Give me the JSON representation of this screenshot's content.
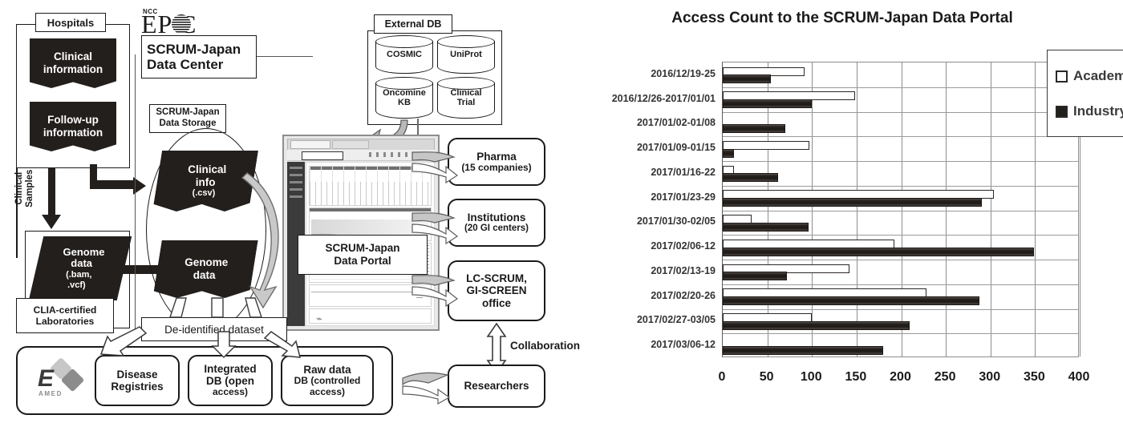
{
  "diagram": {
    "hospitals": {
      "label": "Hospitals",
      "items": [
        "Clinical\ninformation",
        "Follow-up\ninformation"
      ],
      "clinical_information_line1": "Clinical",
      "clinical_information_line2": "information",
      "followup_line1": "Follow-up",
      "followup_line2": "information"
    },
    "clinical_samples_label_line1": "Clinical",
    "clinical_samples_label_line2": "Samples",
    "lab": {
      "genome_line1": "Genome",
      "genome_line2": "data",
      "genome_line3": "(.bam,",
      "genome_line4": ".vcf)",
      "caption_line1": "CLIA-certified",
      "caption_line2": "Laboratories"
    },
    "epoc": {
      "ncc": "NCC",
      "wordmark": "EP  C",
      "title_line1": "SCRUM-Japan",
      "title_line2": "Data Center"
    },
    "storage": {
      "label_line1": "SCRUM-Japan",
      "label_line2": "Data Storage",
      "clinical_line1": "Clinical",
      "clinical_line2": "info",
      "clinical_line3": "(.csv)",
      "genome_line1": "Genome",
      "genome_line2": "data"
    },
    "external_db": {
      "label": "External DB",
      "items": [
        {
          "line1": "COSMIC",
          "line2": ""
        },
        {
          "line1": "UniProt",
          "line2": ""
        },
        {
          "line1": "Oncomine",
          "line2": "KB"
        },
        {
          "line1": "Clinical",
          "line2": "Trial"
        }
      ]
    },
    "portal": {
      "line1": "SCRUM-Japan",
      "line2": "Data Portal"
    },
    "consumers": [
      {
        "line1": "Pharma",
        "line2": "(15 companies)",
        "line3": ""
      },
      {
        "line1": "Institutions",
        "line2": "(20 GI centers)",
        "line3": ""
      },
      {
        "line1": "LC-SCRUM,",
        "line2": "GI-SCREEN",
        "line3": "office"
      }
    ],
    "collaboration_label": "Collaboration",
    "researchers_label": "Researchers",
    "deidentified_label": "De-identified dataset",
    "outputs": [
      {
        "line1": "Disease",
        "line2": "Registries",
        "line3": ""
      },
      {
        "line1": "Integrated",
        "line2": "DB (open",
        "line3": "access)"
      },
      {
        "line1": "Raw data",
        "line2": "DB (controlled",
        "line3": "access)"
      }
    ],
    "amed_logo_text": "AMED"
  },
  "chart_data": {
    "type": "bar",
    "orientation": "horizontal",
    "title": "Access Count to the SCRUM-Japan Data Portal",
    "xlabel": "",
    "ylabel": "",
    "xlim": [
      0,
      400
    ],
    "xticks": [
      0,
      50,
      100,
      150,
      200,
      250,
      300,
      350,
      400
    ],
    "grid": true,
    "legend_position": "top-right",
    "categories": [
      "2016/12/19-25",
      "2016/12/26-2017/01/01",
      "2017/01/02-01/08",
      "2017/01/09-01/15",
      "2017/01/16-22",
      "2017/01/23-29",
      "2017/01/30-02/05",
      "2017/02/06-12",
      "2017/02/13-19",
      "2017/02/20-26",
      "2017/02/27-03/05",
      "2017/03/06-12"
    ],
    "series": [
      {
        "name": "Academia",
        "color": "#ffffff",
        "values": [
          92,
          148,
          0,
          97,
          13,
          304,
          32,
          192,
          142,
          228,
          100,
          0
        ]
      },
      {
        "name": "Industry",
        "color": "#231f1d",
        "values": [
          54,
          100,
          70,
          13,
          62,
          290,
          96,
          349,
          72,
          288,
          209,
          180
        ]
      }
    ]
  }
}
